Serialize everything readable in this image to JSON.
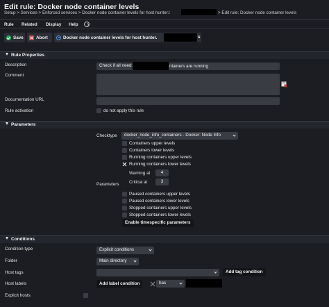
{
  "header": {
    "title": "Edit rule: Docker node container levels",
    "breadcrumb_start": "Setup > Services > Enforced services > Docker node container levels for host hunter.l",
    "breadcrumb_end": "> Edit rule: Docker node container levels"
  },
  "menu": [
    "Rule",
    "Related",
    "Display",
    "Help"
  ],
  "toolbar": {
    "save_label": "Save",
    "abort_label": "Abort",
    "service_label": "Docker node container levels for host hunter.",
    "service_suffix": "s"
  },
  "rule_properties": {
    "section_title": "Rule Properties",
    "description_label": "Description",
    "description_value_start": "Check if all need",
    "description_value_end": "ntainers are running",
    "comment_label": "Comment",
    "doc_url_label": "Documentation URL",
    "rule_activation_label": "Rule activation",
    "do_not_apply_label": "do not apply this rule"
  },
  "parameters": {
    "section_title": "Parameters",
    "checktype_label": "Checktype",
    "checktype_value": "docker_node_info_containers - Docker: Node Info",
    "parameters_label": "Parameters",
    "options_top": [
      {
        "label": "Containers upper levels",
        "checked": false
      },
      {
        "label": "Containers lower levels",
        "checked": false
      },
      {
        "label": "Running containers upper levels",
        "checked": false
      },
      {
        "label": "Running containers lower levels",
        "checked": true
      }
    ],
    "warning_label": "Warning at",
    "warning_value": "4",
    "critical_label": "Critical at",
    "critical_value": "3",
    "options_bottom": [
      {
        "label": "Paused containers upper levels",
        "checked": false
      },
      {
        "label": "Paused containers lower levels",
        "checked": false
      },
      {
        "label": "Stopped containers upper levels",
        "checked": false
      },
      {
        "label": "Stopped containers lower levels",
        "checked": false
      }
    ],
    "timespecific_button": "Enable timespecific parameters"
  },
  "conditions": {
    "section_title": "Conditions",
    "condition_type_label": "Condition type",
    "condition_type_value": "Explicit conditions",
    "folder_label": "Folder",
    "folder_value": "Main directory",
    "host_tags_label": "Host tags",
    "add_tag_button": "Add tag condition",
    "host_labels_label": "Host labels",
    "add_label_button": "Add label condition",
    "label_operator": "has",
    "explicit_hosts_label": "Explicit hosts"
  }
}
